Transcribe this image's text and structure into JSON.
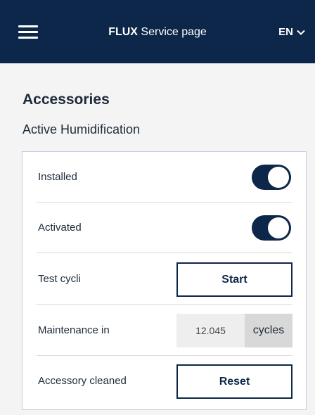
{
  "header": {
    "brand": "FLUX",
    "title": "Service page",
    "language": "EN",
    "menu_icon": "hamburger-menu-icon",
    "language_icon": "chevron-down-icon"
  },
  "section": {
    "title": "Accessories",
    "subtitle": "Active Humidification"
  },
  "rows": {
    "installed": {
      "label": "Installed",
      "state": "on"
    },
    "activated": {
      "label": "Activated",
      "state": "on"
    },
    "test_cycli": {
      "label": "Test cycli",
      "button_label": "Start"
    },
    "maintenance": {
      "label": "Maintenance in",
      "value": "12.045",
      "unit": "cycles"
    },
    "accessory_cleaned": {
      "label": "Accessory cleaned",
      "button_label": "Reset"
    }
  },
  "colors": {
    "primary": "#0c2749",
    "background": "#f4f4f4",
    "panel_border": "#c7cbe0"
  }
}
